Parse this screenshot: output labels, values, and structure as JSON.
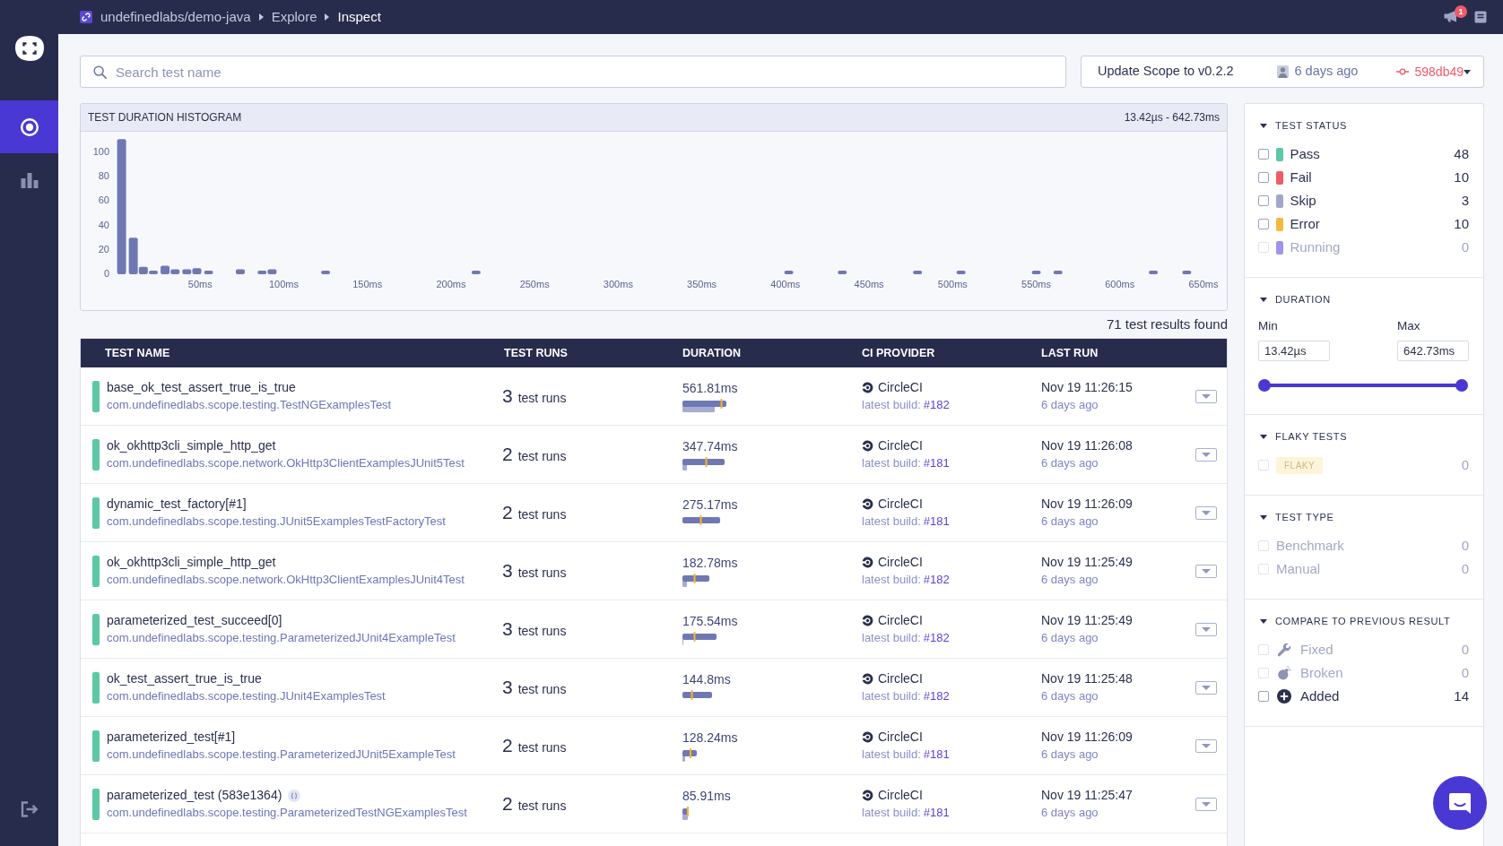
{
  "sidebar": {
    "items": [
      {
        "selected": true
      },
      {
        "selected": false
      }
    ]
  },
  "top_bar": {
    "breadcrumb": [
      {
        "label": "undefinedlabs/demo-java",
        "current": false
      },
      {
        "label": "Explore",
        "current": false
      },
      {
        "label": "Inspect",
        "current": true
      }
    ],
    "notifications": "1"
  },
  "search": {
    "placeholder": "Search test name"
  },
  "scope": {
    "message": "Update Scope to v0.2.2",
    "time": "6 days ago",
    "commit": "598db49"
  },
  "histogram": {
    "title": "TEST DURATION HISTOGRAM",
    "range": "13.42µs - 642.73ms",
    "chart_data": {
      "type": "bar",
      "x": [
        3,
        10,
        16,
        22,
        29,
        35,
        42,
        48,
        55,
        74,
        87,
        93,
        125,
        215,
        402,
        434,
        479,
        505,
        550,
        563,
        620,
        640
      ],
      "values": [
        111,
        30,
        6,
        2,
        7,
        4,
        4,
        5,
        3,
        4,
        3,
        4,
        2,
        2,
        2,
        2,
        2,
        2,
        2,
        2,
        2,
        2
      ],
      "xlim": [
        0,
        650
      ],
      "ylim": [
        0,
        117
      ],
      "xticks": [
        {
          "value": 50,
          "label": "50ms"
        },
        {
          "value": 100,
          "label": "100ms"
        },
        {
          "value": 150,
          "label": "150ms"
        },
        {
          "value": 200,
          "label": "200ms"
        },
        {
          "value": 250,
          "label": "250ms"
        },
        {
          "value": 300,
          "label": "300ms"
        },
        {
          "value": 350,
          "label": "350ms"
        },
        {
          "value": 400,
          "label": "400ms"
        },
        {
          "value": 450,
          "label": "450ms"
        },
        {
          "value": 500,
          "label": "500ms"
        },
        {
          "value": 550,
          "label": "550ms"
        },
        {
          "value": 600,
          "label": "600ms"
        },
        {
          "value": 650,
          "label": "650ms"
        }
      ],
      "yticks": [
        0,
        20,
        40,
        60,
        80,
        100
      ]
    }
  },
  "results_count": "71 test results found",
  "table": {
    "columns": [
      "TEST NAME",
      "TEST RUNS",
      "DURATION",
      "CI PROVIDER",
      "LAST RUN"
    ],
    "rows": [
      {
        "color": "#5cc8a4",
        "name": "base_ok_test_assert_true_is_true",
        "icon": false,
        "class_name": "com.undefinedlabs.scope.testing.TestNGExamplesTest",
        "runs": "3",
        "runs_label": "test runs",
        "duration": "561.81ms",
        "ci": "CircleCI",
        "build_label": "latest build:",
        "build": "#182",
        "last_run": "Nov 19 11:26:15",
        "ago": "6 days ago"
      },
      {
        "color": "#5cc8a4",
        "name": "ok_okhttp3cli_simple_http_get",
        "icon": false,
        "class_name": "com.undefinedlabs.scope.network.OkHttp3ClientExamplesJUnit5Test",
        "runs": "2",
        "runs_label": "test runs",
        "duration": "347.74ms",
        "ci": "CircleCI",
        "build_label": "latest build:",
        "build": "#181",
        "last_run": "Nov 19 11:26:08",
        "ago": "6 days ago"
      },
      {
        "color": "#5cc8a4",
        "name": "dynamic_test_factory[#1]",
        "icon": false,
        "class_name": "com.undefinedlabs.scope.testing.JUnit5ExamplesTestFactoryTest",
        "runs": "2",
        "runs_label": "test runs",
        "duration": "275.17ms",
        "ci": "CircleCI",
        "build_label": "latest build:",
        "build": "#181",
        "last_run": "Nov 19 11:26:09",
        "ago": "6 days ago"
      },
      {
        "color": "#5cc8a4",
        "name": "ok_okhttp3cli_simple_http_get",
        "icon": false,
        "class_name": "com.undefinedlabs.scope.network.OkHttp3ClientExamplesJUnit4Test",
        "runs": "3",
        "runs_label": "test runs",
        "duration": "182.78ms",
        "ci": "CircleCI",
        "build_label": "latest build:",
        "build": "#182",
        "last_run": "Nov 19 11:25:49",
        "ago": "6 days ago"
      },
      {
        "color": "#5cc8a4",
        "name": "parameterized_test_succeed[0]",
        "icon": false,
        "class_name": "com.undefinedlabs.scope.testing.ParameterizedJUnit4ExampleTest",
        "runs": "3",
        "runs_label": "test runs",
        "duration": "175.54ms",
        "ci": "CircleCI",
        "build_label": "latest build:",
        "build": "#182",
        "last_run": "Nov 19 11:25:49",
        "ago": "6 days ago"
      },
      {
        "color": "#5cc8a4",
        "name": "ok_test_assert_true_is_true",
        "icon": false,
        "class_name": "com.undefinedlabs.scope.testing.JUnit4ExamplesTest",
        "runs": "3",
        "runs_label": "test runs",
        "duration": "144.8ms",
        "ci": "CircleCI",
        "build_label": "latest build:",
        "build": "#182",
        "last_run": "Nov 19 11:25:48",
        "ago": "6 days ago"
      },
      {
        "color": "#5cc8a4",
        "name": "parameterized_test[#1]",
        "icon": false,
        "class_name": "com.undefinedlabs.scope.testing.ParameterizedJUnit5ExampleTest",
        "runs": "2",
        "runs_label": "test runs",
        "duration": "128.24ms",
        "ci": "CircleCI",
        "build_label": "latest build:",
        "build": "#181",
        "last_run": "Nov 19 11:26:09",
        "ago": "6 days ago"
      },
      {
        "color": "#5cc8a4",
        "name": "parameterized_test (583e1364)",
        "icon": true,
        "class_name": "com.undefinedlabs.scope.testing.ParameterizedTestNGExamplesTest",
        "runs": "2",
        "runs_label": "test runs",
        "duration": "85.91ms",
        "ci": "CircleCI",
        "build_label": "latest build:",
        "build": "#181",
        "last_run": "Nov 19 11:25:47",
        "ago": "6 days ago"
      }
    ]
  },
  "filters": {
    "sections": [
      {
        "kind": "status",
        "title": "TEST STATUS",
        "expanded": true,
        "items": [
          {
            "label": "Pass",
            "count": "48",
            "color": "#5cc8a4",
            "checked": false,
            "disabled": false
          },
          {
            "label": "Fail",
            "count": "10",
            "color": "#ef5b67",
            "checked": false,
            "disabled": false
          },
          {
            "label": "Skip",
            "count": "3",
            "color": "#a1a7c8",
            "checked": false,
            "disabled": false
          },
          {
            "label": "Error",
            "count": "10",
            "color": "#f5b93c",
            "checked": false,
            "disabled": false
          },
          {
            "label": "Running",
            "count": "0",
            "color": "#a093ee",
            "checked": false,
            "disabled": true
          }
        ]
      },
      {
        "kind": "range",
        "title": "DURATION",
        "expanded": true,
        "min_label": "Min",
        "min_value": "13.42µs",
        "max_label": "Max",
        "max_value": "642.73ms",
        "thumbs": [
          {
            "level": 0
          },
          {
            "level": 1
          }
        ]
      },
      {
        "kind": "badge",
        "title": "FLAKY TESTS",
        "expanded": true,
        "items": [
          {
            "label": "FLAKY",
            "count": "0",
            "checked": false,
            "disabled": true
          }
        ]
      },
      {
        "kind": "plain",
        "title": "TEST TYPE",
        "expanded": true,
        "items": [
          {
            "label": "Benchmark",
            "count": "0",
            "checked": false,
            "disabled": true
          },
          {
            "label": "Manual",
            "count": "0",
            "checked": false,
            "disabled": true
          }
        ]
      },
      {
        "kind": "icon",
        "title": "COMPARE TO PREVIOUS RESULT",
        "expanded": true,
        "items": [
          {
            "label": "Fixed",
            "count": "0",
            "checked": false,
            "disabled": true
          },
          {
            "label": "Broken",
            "count": "0",
            "checked": false,
            "disabled": true
          },
          {
            "label": "Added",
            "count": "14",
            "checked": false,
            "disabled": false
          }
        ]
      }
    ]
  }
}
